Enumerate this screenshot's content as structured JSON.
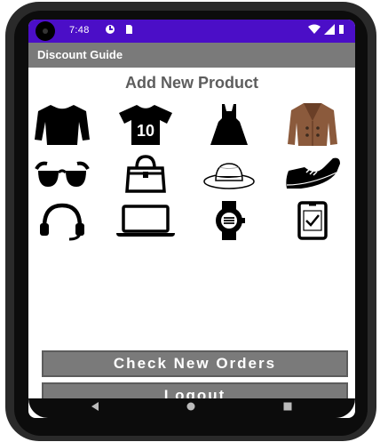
{
  "status_bar": {
    "time": "7:48",
    "icons": [
      "notification-icon",
      "sim-icon",
      "wifi-icon",
      "signal-icon",
      "battery-icon"
    ]
  },
  "app_bar": {
    "title": "Discount Guide"
  },
  "page": {
    "title": "Add New Product"
  },
  "products": [
    {
      "name": "long-sleeve-shirt-icon"
    },
    {
      "name": "jersey-10-icon",
      "label": "10"
    },
    {
      "name": "dress-icon"
    },
    {
      "name": "coat-icon"
    },
    {
      "name": "sunglasses-icon"
    },
    {
      "name": "handbag-icon"
    },
    {
      "name": "hat-icon"
    },
    {
      "name": "sneaker-icon"
    },
    {
      "name": "headphones-icon"
    },
    {
      "name": "laptop-icon"
    },
    {
      "name": "smartwatch-icon"
    },
    {
      "name": "phone-check-icon"
    }
  ],
  "buttons": {
    "check_orders": "Check New Orders",
    "logout": "Logout"
  },
  "colors": {
    "status_bar": "#4b0ec7",
    "app_bar": "#7a7a7a",
    "button": "#7a7a7a",
    "coat": "#8b5a3c"
  }
}
